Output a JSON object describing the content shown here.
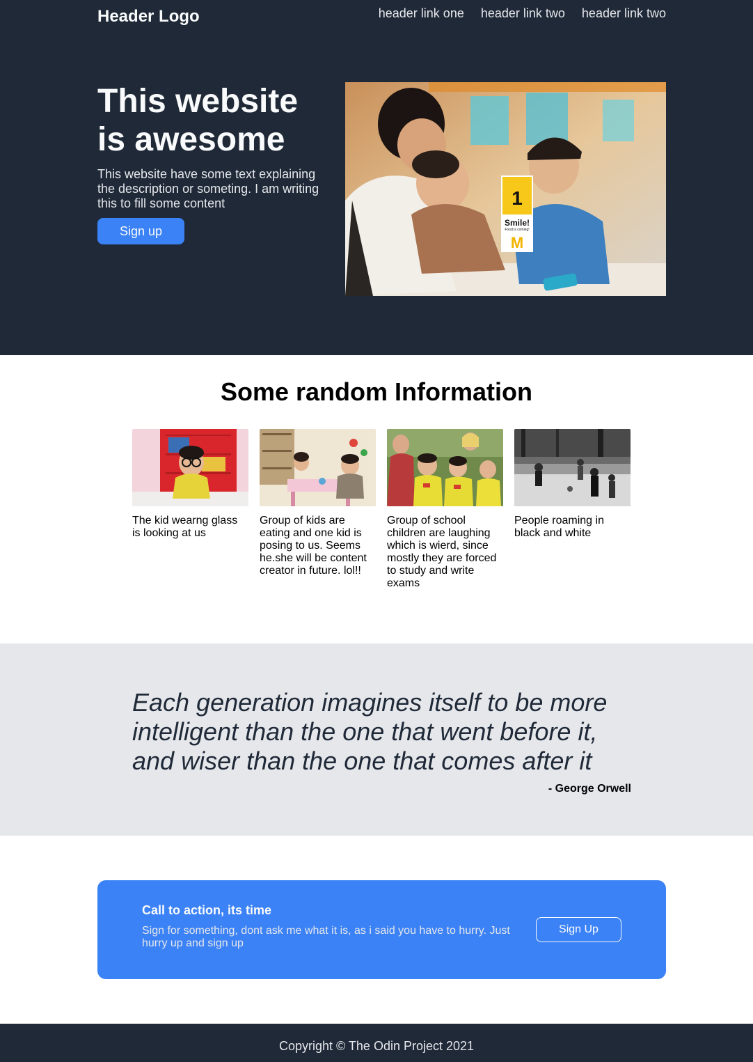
{
  "header": {
    "logo": "Header Logo",
    "nav": [
      "header link one",
      "header link two",
      "header link two"
    ]
  },
  "hero": {
    "title": "This website is awesome",
    "description": "This website have some text explaining the description or someting. I am writing this to fill some content",
    "button_label": "Sign up",
    "image_sign_number": "1",
    "image_sign_text": "Smile!",
    "image_sign_subtext": "Food is coming!"
  },
  "info": {
    "title": "Some random Information",
    "cards": [
      {
        "text": "The kid wearng glass is looking at us"
      },
      {
        "text": "Group of kids are eating and one kid is posing to us. Seems he.she will be content creator in future. lol!!"
      },
      {
        "text": "Group of school children are laughing which is wierd, since mostly they are forced to study and write exams"
      },
      {
        "text": "People roaming in black and white"
      }
    ]
  },
  "quote": {
    "text": "Each generation imagines itself to be more intelligent than the one that went before it, and wiser than the one that comes after it",
    "author": "- George Orwell"
  },
  "cta": {
    "title": "Call to action, its time",
    "description": "Sign for something, dont ask me what it is, as i said you have to hurry. Just hurry up and sign up",
    "button_label": "Sign Up"
  },
  "footer": {
    "copyright": "Copyright © The Odin Project 2021"
  },
  "colors": {
    "dark": "#1f2937",
    "accent": "#3b82f6",
    "quote_bg": "#e5e7eb"
  }
}
